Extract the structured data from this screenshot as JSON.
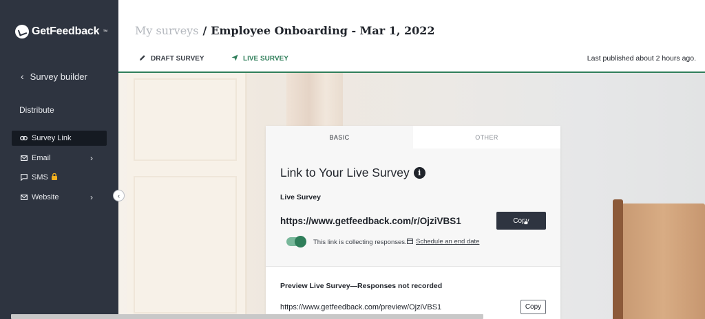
{
  "app": {
    "brand": "GetFeedback",
    "brand_mark": "™"
  },
  "sidebar": {
    "back_label": "Survey builder",
    "section_label": "Distribute",
    "items": [
      {
        "label": "Survey Link",
        "icon": "link-icon",
        "active": true
      },
      {
        "label": "Email",
        "icon": "mail-icon",
        "has_submenu": true
      },
      {
        "label": "SMS",
        "icon": "chat-icon",
        "locked": true
      },
      {
        "label": "Website",
        "icon": "mail-icon",
        "has_submenu": true
      }
    ]
  },
  "header": {
    "breadcrumb_parent": "My surveys",
    "breadcrumb_separator": "/",
    "survey_title": "Employee Onboarding - Mar 1, 2022",
    "tabs": [
      {
        "label": "DRAFT SURVEY",
        "icon": "pencil-icon"
      },
      {
        "label": "LIVE SURVEY",
        "icon": "send-icon",
        "active": true
      }
    ],
    "published_status": "Last published about 2 hours ago."
  },
  "card": {
    "tabs": [
      {
        "label": "BASIC",
        "active": true
      },
      {
        "label": "OTHER"
      }
    ],
    "title": "Link to Your Live Survey",
    "info_glyph": "i",
    "live_label": "Live Survey",
    "live_url": "https://www.getfeedback.com/r/OjziVBS1",
    "copy_label": "Copy",
    "collecting_text": "This link is collecting responses.",
    "collecting_enabled": true,
    "schedule_label": "Schedule an end date",
    "preview_label": "Preview Live Survey—Responses not recorded",
    "preview_url": "https://www.getfeedback.com/preview/OjziVBS1",
    "preview_copy_label": "Copy"
  },
  "colors": {
    "sidebar_bg": "#2e3440",
    "accent_green": "#2f7e5a",
    "lock_yellow": "#f2b01e"
  }
}
